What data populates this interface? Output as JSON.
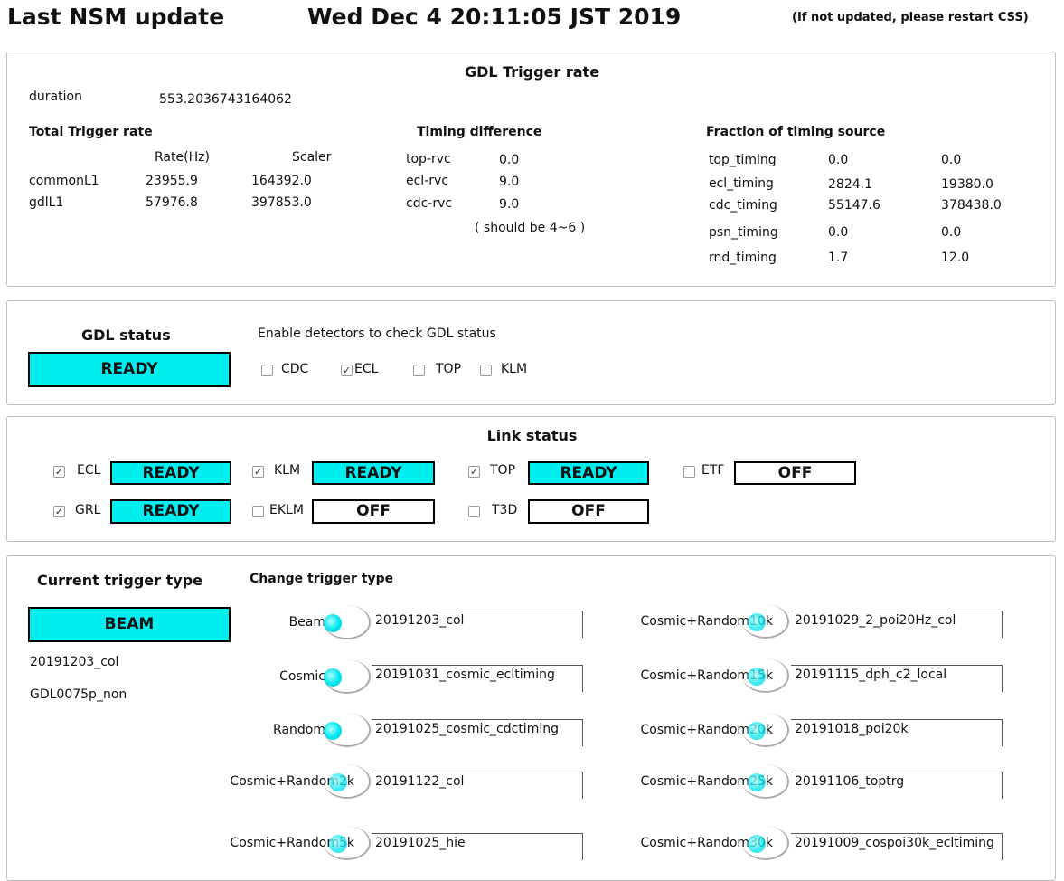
{
  "header": {
    "title": "Last NSM update",
    "timestamp": "Wed Dec  4 20:11:05 JST 2019",
    "note": "(If not updated, please restart CSS)"
  },
  "trigger_rate": {
    "title": "GDL Trigger rate",
    "duration_label": "duration",
    "duration_value": "553.2036743164062",
    "total": {
      "heading": "Total Trigger rate",
      "col_rate": "Rate(Hz)",
      "col_scaler": "Scaler",
      "rows": [
        {
          "name": "commonL1",
          "rate": "23955.9",
          "scaler": "164392.0"
        },
        {
          "name": "gdlL1",
          "rate": "57976.8",
          "scaler": "397853.0"
        }
      ]
    },
    "timing_diff": {
      "heading": "Timing difference",
      "rows": [
        {
          "name": "top-rvc",
          "value": "0.0"
        },
        {
          "name": "ecl-rvc",
          "value": "9.0"
        },
        {
          "name": "cdc-rvc",
          "value": "9.0"
        }
      ],
      "note": "( should be 4~6 )"
    },
    "fraction": {
      "heading": "Fraction of timing source",
      "rows": [
        {
          "name": "top_timing",
          "rate": "0.0",
          "scaler": "0.0"
        },
        {
          "name": "ecl_timing",
          "rate": "2824.1",
          "scaler": "19380.0"
        },
        {
          "name": "cdc_timing",
          "rate": "55147.6",
          "scaler": "378438.0"
        },
        {
          "name": "psn_timing",
          "rate": "0.0",
          "scaler": "0.0"
        },
        {
          "name": "rnd_timing",
          "rate": "1.7",
          "scaler": "12.0"
        }
      ]
    }
  },
  "gdl_status": {
    "title": "GDL status",
    "status": "READY",
    "enable_label": "Enable detectors to check GDL status",
    "detectors": [
      {
        "label": "CDC",
        "checked": false
      },
      {
        "label": "ECL",
        "checked": true
      },
      {
        "label": "TOP",
        "checked": false
      },
      {
        "label": "KLM",
        "checked": false
      }
    ]
  },
  "link_status": {
    "title": "Link status",
    "links": [
      {
        "label": "ECL",
        "checked": true,
        "status": "READY"
      },
      {
        "label": "KLM",
        "checked": true,
        "status": "READY"
      },
      {
        "label": "TOP",
        "checked": true,
        "status": "READY"
      },
      {
        "label": "ETF",
        "checked": false,
        "status": "OFF"
      },
      {
        "label": "GRL",
        "checked": true,
        "status": "READY"
      },
      {
        "label": "EKLM",
        "checked": false,
        "status": "OFF"
      },
      {
        "label": "T3D",
        "checked": false,
        "status": "OFF"
      }
    ]
  },
  "trigger_type": {
    "current_title": "Current trigger type",
    "current_value": "BEAM",
    "current_file": "20191203_col",
    "current_psnm": "GDL0075p_non",
    "change_title": "Change trigger type",
    "left": [
      {
        "label": "Beam",
        "value": "20191203_col"
      },
      {
        "label": "Cosmic",
        "value": "20191031_cosmic_ecltiming"
      },
      {
        "label": "Random",
        "value": "20191025_cosmic_cdctiming"
      },
      {
        "label": "Cosmic+Random2k",
        "value": "20191122_col"
      },
      {
        "label": "Cosmic+Random5k",
        "value": "20191025_hie"
      }
    ],
    "right": [
      {
        "label": "Cosmic+Random10k",
        "value": "20191029_2_poi20Hz_col"
      },
      {
        "label": "Cosmic+Random15k",
        "value": "20191115_dph_c2_local"
      },
      {
        "label": "Cosmic+Random20k",
        "value": "20191018_poi20k"
      },
      {
        "label": "Cosmic+Random25k",
        "value": "20191106_toptrg"
      },
      {
        "label": "Cosmic+Random30k",
        "value": "20191009_cospoi30k_ecltiming"
      }
    ]
  },
  "colors": {
    "ready": "#00eef0",
    "off": "#ffffff"
  }
}
